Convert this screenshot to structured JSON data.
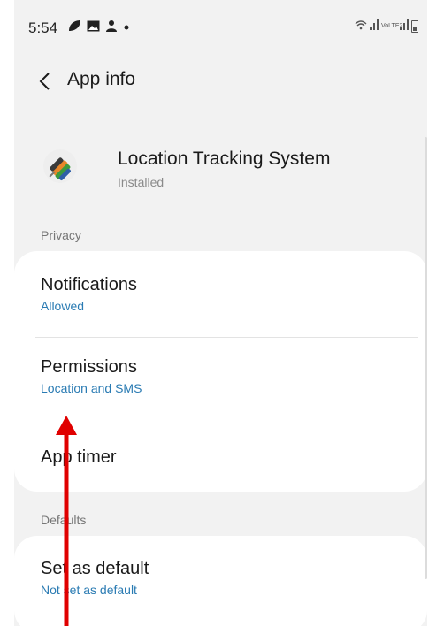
{
  "status_bar": {
    "time": "5:54",
    "left_icons": [
      "leaf-icon",
      "image-icon",
      "person-icon",
      "dot-icon"
    ],
    "right_icons": [
      "wifi-icon",
      "signal-icon",
      "volte-icon",
      "signal-icon",
      "battery-icon"
    ],
    "volte_text": "VoLTE2"
  },
  "header": {
    "title": "App info",
    "back_icon": "chevron-left-icon"
  },
  "app": {
    "name": "Location Tracking System",
    "status": "Installed",
    "icon": "app-logo-icon"
  },
  "sections": {
    "privacy_label": "Privacy",
    "defaults_label": "Defaults"
  },
  "privacy_items": [
    {
      "title": "Notifications",
      "subtitle": "Allowed"
    },
    {
      "title": "Permissions",
      "subtitle": "Location and SMS"
    },
    {
      "title": "App timer",
      "subtitle": ""
    }
  ],
  "defaults_items": [
    {
      "title": "Set as default",
      "subtitle": "Not set as default"
    }
  ],
  "colors": {
    "background": "#f2f2f2",
    "card": "#ffffff",
    "link_blue": "#2a7bb3",
    "annotation_red": "#e00000"
  }
}
